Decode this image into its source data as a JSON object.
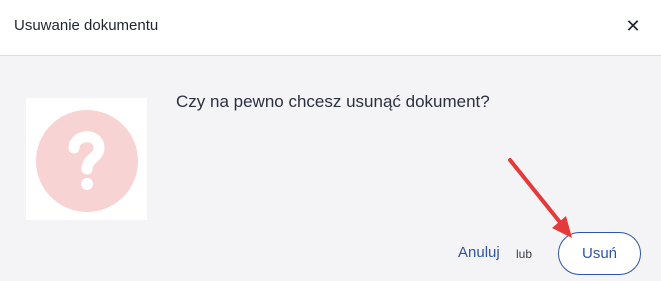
{
  "dialog": {
    "title": "Usuwanie dokumentu",
    "close_icon": "close-icon",
    "question": "Czy na pewno chcesz usunąć dokument?",
    "illustration_icon": "question-mark-icon",
    "cancel_label": "Anuluj",
    "or_label": "lub",
    "delete_label": "Usuń"
  },
  "colors": {
    "accent": "#2d55a4",
    "annotation_arrow": "#e53a3a",
    "illustration_circle": "#f8d3d3"
  }
}
